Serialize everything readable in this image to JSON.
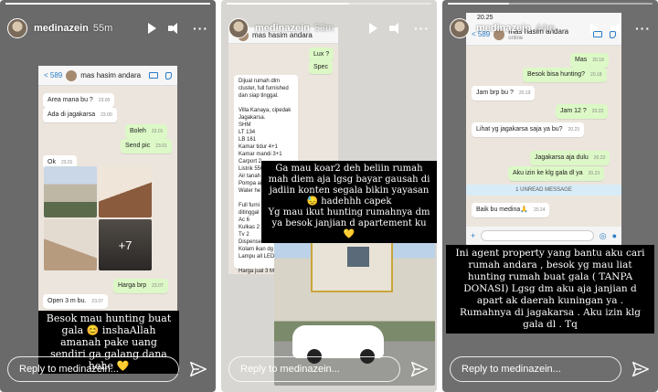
{
  "stories": [
    {
      "username": "medinazein",
      "time": "55m",
      "reply_placeholder": "Reply to medinazein...",
      "chat": {
        "back": "< 589",
        "contact": "mas hasim andara",
        "messages": [
          {
            "text": "Area mana bu ?",
            "time": "23.00"
          },
          {
            "text": "Ada di jagakarsa",
            "time": "23.00"
          },
          {
            "text": "Boleh",
            "time": "23.01"
          },
          {
            "text": "Send pic",
            "time": "23.01"
          },
          {
            "text": "Ok",
            "time": "23.01"
          },
          {
            "text": "Harga brp",
            "time": "23.07"
          },
          {
            "text": "Open 3 m bu.",
            "time": "23.07"
          }
        ],
        "more_photos": "+7"
      },
      "caption": "Besok mau hunting buat gala 😊 inshaAllah amanah pake uang sendiri ga galang dana hehe 💛"
    },
    {
      "username": "medinazein",
      "time": "53m",
      "reply_placeholder": "Reply to medinazein...",
      "chat": {
        "contact": "mas hasim andara",
        "messages": [
          {
            "text": "Lux ?",
            "time": "23.06"
          },
          {
            "text": "Spec",
            "time": "23.06"
          }
        ],
        "listing": "Dijual rumah dlm cluster, full furnished dan siap tinggal.\n\nVilla Kanaya, cipedak Jagakarsa.\nSHM\nLT 134\nLB 161\nKamar tidur 4+1\nKamar mandi 3+1\nCarport 2\nListrik 5500watt\nAir tanah\nPompa air\nWater he\n\nFull furni\nditinggal\nAc 6\nKulkas 2\nTv 2\nDispenser\nKolam ikan dg f\nLampu all LED\n\nHarga jual 3 M"
      },
      "caption": "Ga mau koar2 deh beliin rumah mah diem aja lgsg bayar gausah di jadiin konten segala bikin yayasan 😓 hadehhh capek\nYg mau ikut hunting rumahnya dm ya besok janjian d apartement ku 💛"
    },
    {
      "username": "medinazein",
      "time": "44m",
      "reply_placeholder": "Reply to medinazein...",
      "chat": {
        "status_time": "20.25",
        "back": "< 589",
        "contact": "mas hasim andara",
        "contact_sub": "online",
        "messages": [
          {
            "text": "Mas",
            "time": "20.18"
          },
          {
            "text": "Besok bisa hunting?",
            "time": "20.18"
          },
          {
            "text": "Jam brp bu ?",
            "time": "20.19"
          },
          {
            "text": "Jam 12 ?",
            "time": "20.22"
          },
          {
            "text": "Lihat yg jagakarsa saja ya bu?",
            "time": "20.23"
          },
          {
            "text": "Jagakarsa aja dulu",
            "time": "20.23"
          },
          {
            "text": "Aku izin ke klg gala dl ya",
            "time": "20.23"
          },
          {
            "text": "Baik bu medina🙏",
            "time": "20.24"
          }
        ],
        "unread": "1 UNREAD MESSAGE"
      },
      "caption": "Ini agent property yang bantu aku cari rumah andara , besok yg mau liat hunting rumah buat gala ( TANPA DONASI) Lgsg dm aku aja janjian d apart ak daerah kuningan ya . Rumahnya di jagakarsa . Aku izin klg gala dl . Tq"
    }
  ],
  "icons": [
    "play-icon",
    "mute-icon",
    "more-icon",
    "send-icon",
    "video-call-icon",
    "phone-icon"
  ]
}
